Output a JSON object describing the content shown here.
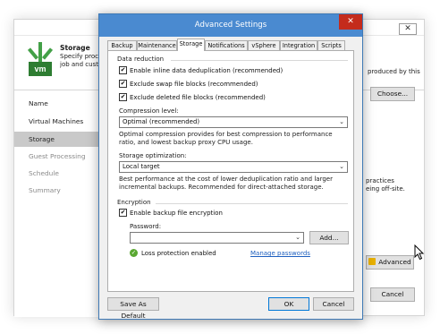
{
  "background_window": {
    "close_glyph": "✕",
    "header": {
      "title": "Storage",
      "description_line1": "Specify process",
      "description_line2": "job and custom",
      "right_text": "produced by this",
      "logo_text": "vm"
    },
    "nav": [
      {
        "label": "Name"
      },
      {
        "label": "Virtual Machines"
      },
      {
        "label": "Storage"
      },
      {
        "label": "Guest Processing"
      },
      {
        "label": "Schedule"
      },
      {
        "label": "Summary"
      }
    ],
    "choose_button": "Choose...",
    "side_text_line1": "practices",
    "side_text_line2": "eing off-site.",
    "advanced_button": "Advanced",
    "cancel_button": "Cancel"
  },
  "dialog": {
    "title": "Advanced Settings",
    "close_glyph": "✕",
    "tabs": [
      {
        "label": "Backup"
      },
      {
        "label": "Maintenance"
      },
      {
        "label": "Storage"
      },
      {
        "label": "Notifications"
      },
      {
        "label": "vSphere"
      },
      {
        "label": "Integration"
      },
      {
        "label": "Scripts"
      }
    ],
    "active_tab": "Storage",
    "data_reduction": {
      "heading": "Data reduction",
      "options": [
        {
          "label": "Enable inline data deduplication (recommended)",
          "checked": true
        },
        {
          "label": "Exclude swap file blocks (recommended)",
          "checked": true
        },
        {
          "label": "Exclude deleted file blocks (recommended)",
          "checked": true
        }
      ],
      "check_glyph": "✔"
    },
    "compression": {
      "label": "Compression level:",
      "value": "Optimal (recommended)",
      "description": "Optimal compression provides for best compression to performance ratio, and lowest backup proxy CPU usage."
    },
    "storage_optimization": {
      "label": "Storage optimization:",
      "value": "Local target",
      "description": "Best performance at the cost of lower deduplication ratio and larger incremental backups. Recommended for direct-attached storage."
    },
    "encryption": {
      "heading": "Encryption",
      "enable_label": "Enable backup file encryption",
      "enabled": true,
      "password_label": "Password:",
      "password_value": "",
      "add_button": "Add...",
      "status_text": "Loss protection enabled",
      "status_icon": "check-circle-icon",
      "manage_link": "Manage passwords"
    },
    "chevron_glyph": "⌄",
    "footer": {
      "save_default": "Save As Default",
      "ok": "OK",
      "cancel": "Cancel"
    }
  },
  "colors": {
    "title_bar": "#4a8ad0",
    "close_button": "#c42b1c",
    "link": "#1e5fbf",
    "success": "#5aa832",
    "logo_green": "#2e7d32"
  }
}
